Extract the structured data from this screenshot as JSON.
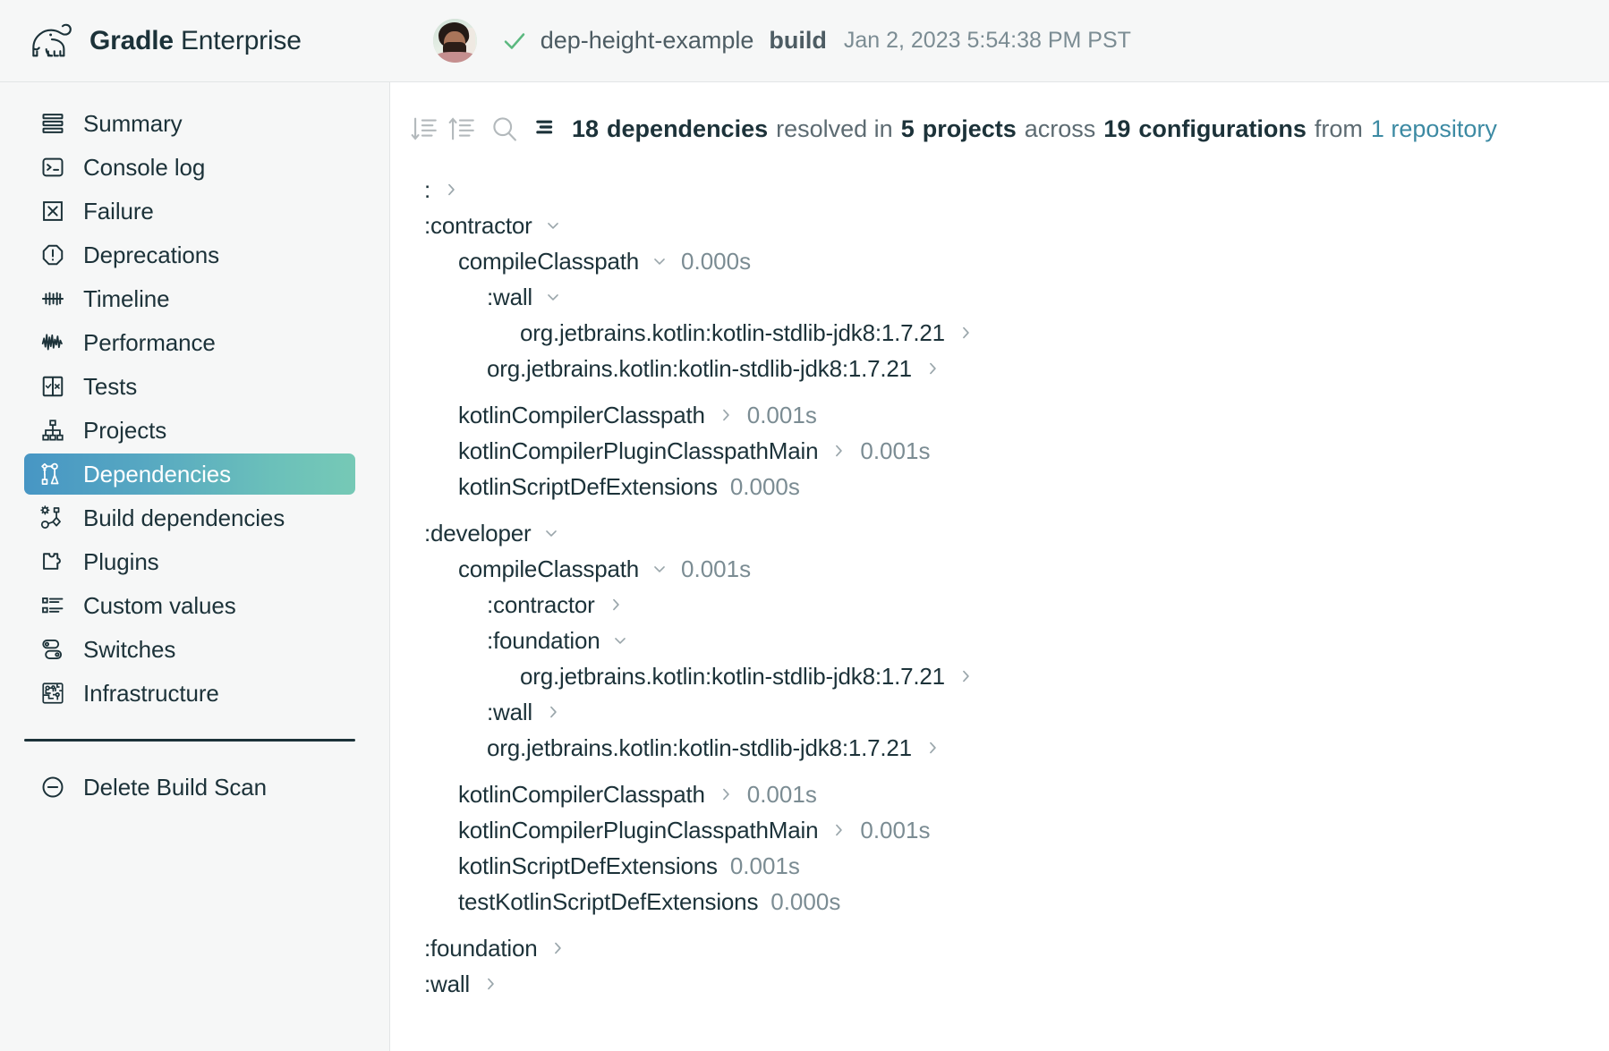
{
  "brand": {
    "bold": "Gradle",
    "light": "Enterprise",
    "logo_icon": "gradle-elephant-logo"
  },
  "header": {
    "avatar_icon": "user-avatar",
    "status_icon": "check-icon",
    "scan_title": "dep-height-example",
    "scan_task": "build",
    "timestamp": "Jan 2, 2023 5:54:38 PM PST"
  },
  "sidebar": {
    "items": [
      {
        "label": "Summary",
        "icon": "summary-icon",
        "active": false
      },
      {
        "label": "Console log",
        "icon": "console-log-icon",
        "active": false
      },
      {
        "label": "Failure",
        "icon": "failure-icon",
        "active": false
      },
      {
        "label": "Deprecations",
        "icon": "deprecations-icon",
        "active": false
      },
      {
        "label": "Timeline",
        "icon": "timeline-icon",
        "active": false
      },
      {
        "label": "Performance",
        "icon": "performance-icon",
        "active": false
      },
      {
        "label": "Tests",
        "icon": "tests-icon",
        "active": false
      },
      {
        "label": "Projects",
        "icon": "projects-icon",
        "active": false
      },
      {
        "label": "Dependencies",
        "icon": "dependencies-icon",
        "active": true
      },
      {
        "label": "Build dependencies",
        "icon": "build-dependencies-icon",
        "active": false
      },
      {
        "label": "Plugins",
        "icon": "plugins-icon",
        "active": false
      },
      {
        "label": "Custom values",
        "icon": "custom-values-icon",
        "active": false
      },
      {
        "label": "Switches",
        "icon": "switches-icon",
        "active": false
      },
      {
        "label": "Infrastructure",
        "icon": "infrastructure-icon",
        "active": false
      }
    ],
    "delete_action": {
      "label": "Delete Build Scan",
      "icon": "minus-circle-icon"
    }
  },
  "toolbar": {
    "sort_desc_icon": "sort-descending-icon",
    "sort_asc_icon": "sort-ascending-icon",
    "search_icon": "search-icon",
    "list_icon": "list-icon"
  },
  "summary": {
    "count": "18",
    "count_label": "dependencies",
    "resolved_in": "resolved in",
    "projects_count": "5",
    "projects_label": "projects",
    "across": "across",
    "configs_count": "19",
    "configs_label": "configurations",
    "from": "from",
    "repo_link": "1 repository"
  },
  "colors": {
    "accent_link": "#3c8aa3",
    "active_gradient_start": "#4796c4",
    "active_gradient_end": "#76c9b6",
    "text_primary": "#1c3239",
    "text_muted": "#7b8c93",
    "sidebar_bg": "#f6f7f7",
    "check_green": "#5bb87f"
  },
  "tree": {
    "rows": [
      {
        "name": ":",
        "level": 0,
        "chevron": "right",
        "duration": "",
        "gap": false
      },
      {
        "name": ":contractor",
        "level": 0,
        "chevron": "down",
        "duration": "",
        "gap": false
      },
      {
        "name": "compileClasspath",
        "level": 1,
        "chevron": "down",
        "duration": "0.000s",
        "gap": false
      },
      {
        "name": ":wall",
        "level": 2,
        "chevron": "down",
        "duration": "",
        "gap": false
      },
      {
        "name": "org.jetbrains.kotlin:kotlin-stdlib-jdk8:1.7.21",
        "level": 3,
        "chevron": "right",
        "duration": "",
        "gap": false
      },
      {
        "name": "org.jetbrains.kotlin:kotlin-stdlib-jdk8:1.7.21",
        "level": 2,
        "chevron": "right",
        "duration": "",
        "gap": false
      },
      {
        "name": "kotlinCompilerClasspath",
        "level": 1,
        "chevron": "right",
        "duration": "0.001s",
        "gap": true
      },
      {
        "name": "kotlinCompilerPluginClasspathMain",
        "level": 1,
        "chevron": "right",
        "duration": "0.001s",
        "gap": false
      },
      {
        "name": "kotlinScriptDefExtensions",
        "level": 1,
        "chevron": "none",
        "duration": "0.000s",
        "gap": false
      },
      {
        "name": ":developer",
        "level": 0,
        "chevron": "down",
        "duration": "",
        "gap": true
      },
      {
        "name": "compileClasspath",
        "level": 1,
        "chevron": "down",
        "duration": "0.001s",
        "gap": false
      },
      {
        "name": ":contractor",
        "level": 2,
        "chevron": "right",
        "duration": "",
        "gap": false
      },
      {
        "name": ":foundation",
        "level": 2,
        "chevron": "down",
        "duration": "",
        "gap": false
      },
      {
        "name": "org.jetbrains.kotlin:kotlin-stdlib-jdk8:1.7.21",
        "level": 3,
        "chevron": "right",
        "duration": "",
        "gap": false
      },
      {
        "name": ":wall",
        "level": 2,
        "chevron": "right",
        "duration": "",
        "gap": false
      },
      {
        "name": "org.jetbrains.kotlin:kotlin-stdlib-jdk8:1.7.21",
        "level": 2,
        "chevron": "right",
        "duration": "",
        "gap": false
      },
      {
        "name": "kotlinCompilerClasspath",
        "level": 1,
        "chevron": "right",
        "duration": "0.001s",
        "gap": true
      },
      {
        "name": "kotlinCompilerPluginClasspathMain",
        "level": 1,
        "chevron": "right",
        "duration": "0.001s",
        "gap": false
      },
      {
        "name": "kotlinScriptDefExtensions",
        "level": 1,
        "chevron": "none",
        "duration": "0.001s",
        "gap": false
      },
      {
        "name": "testKotlinScriptDefExtensions",
        "level": 1,
        "chevron": "none",
        "duration": "0.000s",
        "gap": false
      },
      {
        "name": ":foundation",
        "level": 0,
        "chevron": "right",
        "duration": "",
        "gap": true
      },
      {
        "name": ":wall",
        "level": 0,
        "chevron": "right",
        "duration": "",
        "gap": false
      }
    ]
  }
}
